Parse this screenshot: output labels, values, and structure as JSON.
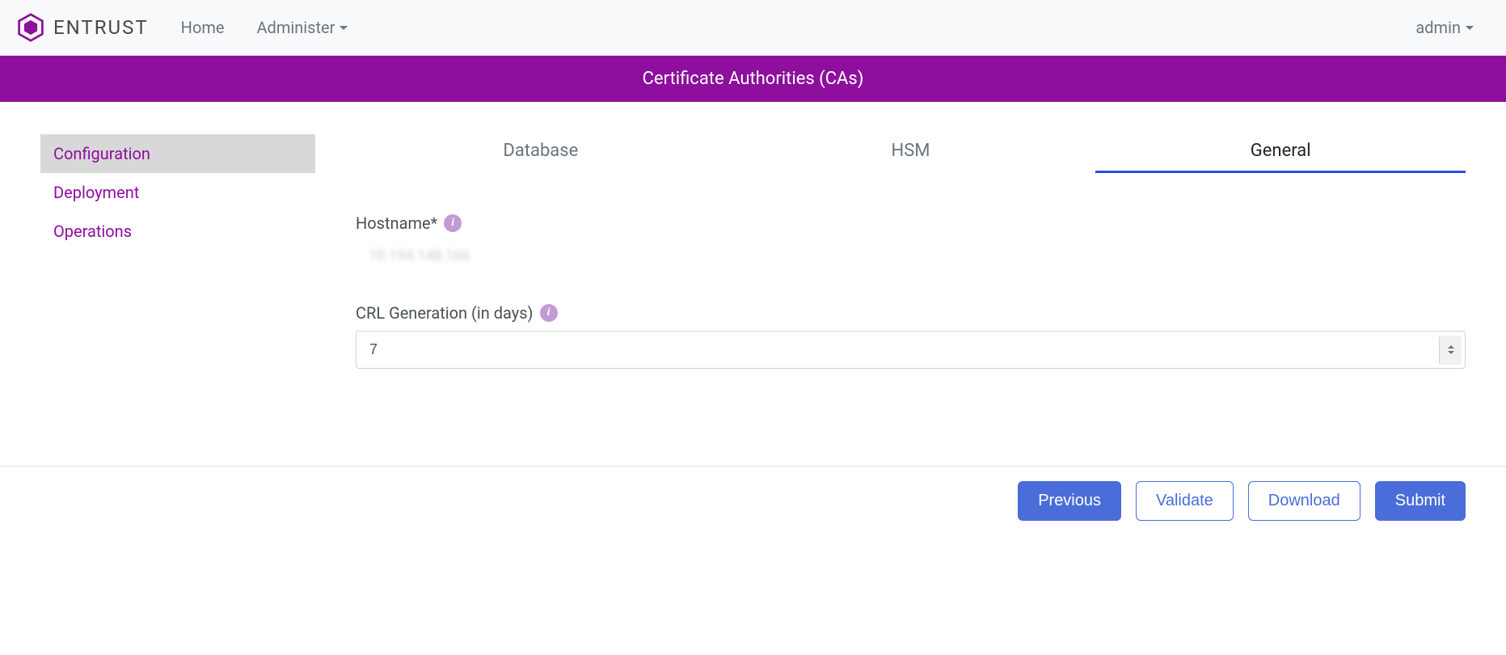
{
  "brand": {
    "name": "ENTRUST"
  },
  "nav": {
    "home": "Home",
    "administer": "Administer"
  },
  "user": {
    "name": "admin"
  },
  "page": {
    "title": "Certificate Authorities (CAs)"
  },
  "sidebar": {
    "items": [
      {
        "label": "Configuration",
        "active": true
      },
      {
        "label": "Deployment",
        "active": false
      },
      {
        "label": "Operations",
        "active": false
      }
    ]
  },
  "tabs": [
    {
      "label": "Database",
      "active": false
    },
    {
      "label": "HSM",
      "active": false
    },
    {
      "label": "General",
      "active": true
    }
  ],
  "form": {
    "hostname_label": "Hostname*",
    "hostname_value": "10.194.148.166",
    "crl_label": "CRL Generation (in days)",
    "crl_value": "7"
  },
  "buttons": {
    "previous": "Previous",
    "validate": "Validate",
    "download": "Download",
    "submit": "Submit"
  }
}
